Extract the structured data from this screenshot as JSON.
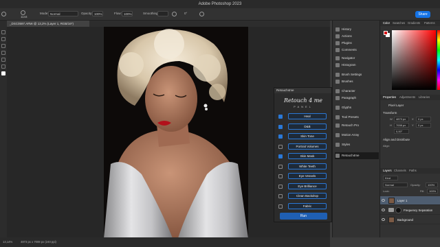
{
  "window": {
    "title": "Adobe Photoshop 2023",
    "share_label": "Share"
  },
  "options_bar": {
    "brush_size": "1144",
    "mode_label": "Mode:",
    "mode_value": "Normal",
    "opacity_label": "Opacity:",
    "opacity_value": "100%",
    "flow_label": "Flow:",
    "flow_value": "100%",
    "smoothing_label": "Smoothing:",
    "smoothing_value": "",
    "angle_value": "0°"
  },
  "document": {
    "tab_label": "_DSC0597.ARW @ 13,2% (Layer 1, RGB/16*)"
  },
  "status": {
    "zoom": "13,14%",
    "dimensions": "4873 px x 7008 px (240 ppi)"
  },
  "retouch_panel": {
    "header": "Retouch4me",
    "logo_text": "Retouch 4 me",
    "subtitle": "PANEL",
    "items": [
      {
        "label": "Heal",
        "checked": true
      },
      {
        "label": "D&B",
        "checked": true
      },
      {
        "label": "Skin Tone",
        "checked": true
      },
      {
        "label": "Portrait Volumes",
        "checked": false
      },
      {
        "label": "Skin Mask",
        "checked": true
      },
      {
        "label": "White Teeth",
        "checked": false
      },
      {
        "label": "Eye Vessels",
        "checked": false
      },
      {
        "label": "Eye Brilliance",
        "checked": false
      },
      {
        "label": "Clean Backdrop",
        "checked": false
      },
      {
        "label": "Fabric",
        "checked": false
      }
    ],
    "run_label": "Run"
  },
  "mid_panel": {
    "items": [
      {
        "label": "History",
        "icon": "history-icon"
      },
      {
        "label": "Actions",
        "icon": "actions-icon"
      },
      {
        "label": "Plugins",
        "icon": "plugins-icon"
      },
      {
        "label": "Comments",
        "icon": "comments-icon"
      },
      {
        "label": "Navigator",
        "icon": "navigator-icon"
      },
      {
        "label": "Histogram",
        "icon": "histogram-icon"
      },
      {
        "label": "Brush Settings",
        "icon": "brush-settings-icon"
      },
      {
        "label": "Brushes",
        "icon": "brushes-icon"
      },
      {
        "label": "Character",
        "icon": "character-icon"
      },
      {
        "label": "Paragraph",
        "icon": "paragraph-icon"
      },
      {
        "label": "Glyphs",
        "icon": "glyphs-icon"
      },
      {
        "label": "Tool Presets",
        "icon": "tool-presets-icon"
      },
      {
        "label": "Retouch Pro",
        "icon": "retouch-pro-icon"
      },
      {
        "label": "Motion Array",
        "icon": "motion-array-icon"
      },
      {
        "label": "Styles",
        "icon": "styles-icon"
      },
      {
        "label": "Retouch4me",
        "icon": "retouch4me-icon"
      }
    ]
  },
  "right_panel": {
    "color_tabs": [
      "Color",
      "Swatches",
      "Gradients",
      "Patterns"
    ],
    "prop_tabs": [
      "Properties",
      "Adjustments",
      "Libraries"
    ],
    "pixel_layer": "Pixel Layer",
    "transform_label": "Transform",
    "w_label": "W",
    "w_value": "4873 px",
    "h_label": "H",
    "h_value": "7008 px",
    "x_label": "X",
    "x_value": "0 px",
    "y_label": "Y",
    "y_value": "0 px",
    "angle_value": "0,00°",
    "align_label": "Align and Distribute",
    "align_sub": "Align:",
    "layer_tabs": [
      "Layers",
      "Channels",
      "Paths"
    ],
    "kind_label": "Kind",
    "blend_mode": "Normal",
    "opacity_label": "Opacity:",
    "opacity_value": "100%",
    "lock_label": "Lock:",
    "fill_label": "Fill:",
    "fill_value": "100%",
    "layers": [
      {
        "name": "Layer 1",
        "selected": true
      },
      {
        "name": "Frequency Separation",
        "selected": false
      },
      {
        "name": "Background",
        "selected": false
      }
    ]
  },
  "colors": {
    "accent": "#1473e6",
    "checkbox_on": "#2a78d6",
    "foreground": "#d81518",
    "background": "#ffffff"
  }
}
